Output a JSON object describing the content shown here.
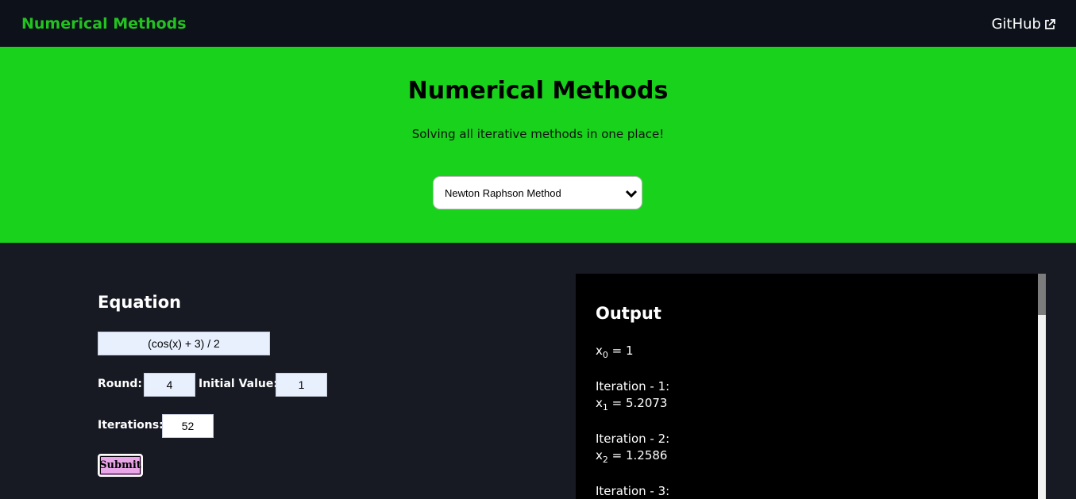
{
  "nav": {
    "brand": "Numerical Methods",
    "github_label": "GitHub",
    "github_icon": "external-link-icon"
  },
  "hero": {
    "title": "Numerical Methods",
    "subtitle": "Solving all iterative methods in one place!",
    "method_select": {
      "selected": "Newton Raphson Method"
    }
  },
  "form": {
    "heading": "Equation",
    "equation": "(cos(x) + 3) / 2",
    "round_label": "Round:",
    "round_value": "4",
    "initial_label": "Initial Value:",
    "initial_value": "1",
    "iterations_label": "Iterations:",
    "iterations_value": "52",
    "submit_label": "Submit"
  },
  "output": {
    "heading": "Output",
    "x0_var": "x",
    "x0_sub": "0",
    "x0_val": " = 1",
    "iterations": [
      {
        "label": "Iteration - 1:",
        "var": "x",
        "sub": "1",
        "val": " = 5.2073"
      },
      {
        "label": "Iteration - 2:",
        "var": "x",
        "sub": "2",
        "val": " = 1.2586"
      },
      {
        "label": "Iteration - 3:"
      }
    ]
  },
  "colors": {
    "accent": "#19d21c",
    "brand": "#22c31f",
    "background": "#171a23",
    "submit": "#e8a5e8"
  }
}
